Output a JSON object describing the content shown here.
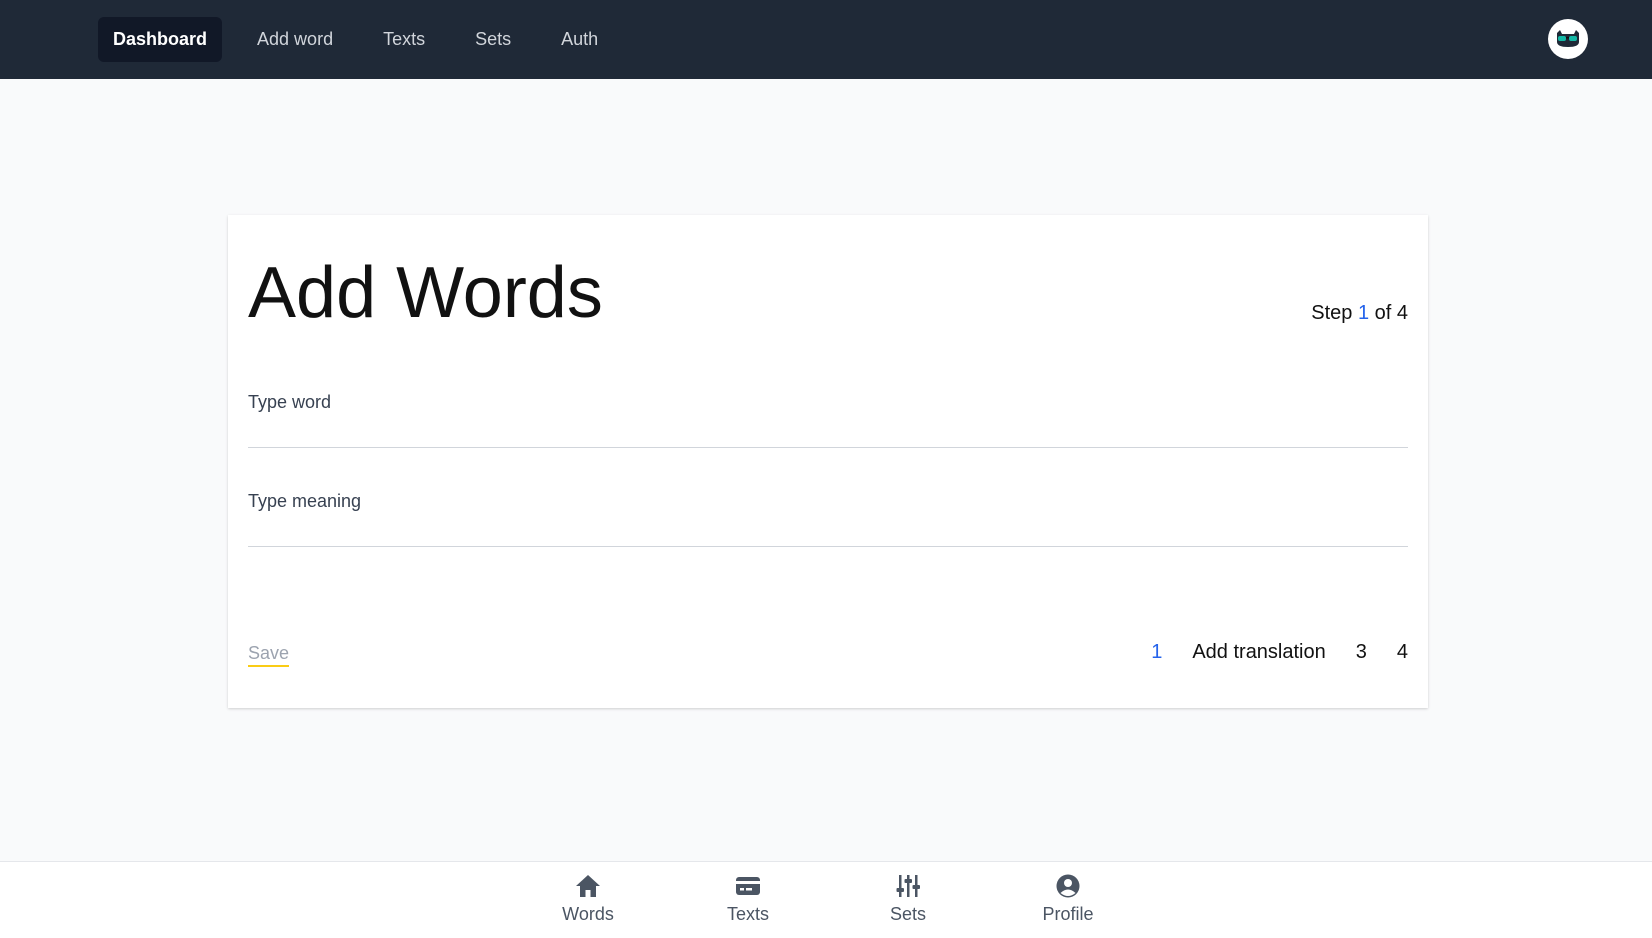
{
  "nav": {
    "items": [
      {
        "label": "Dashboard",
        "active": true
      },
      {
        "label": "Add word",
        "active": false
      },
      {
        "label": "Texts",
        "active": false
      },
      {
        "label": "Sets",
        "active": false
      },
      {
        "label": "Auth",
        "active": false
      }
    ],
    "avatar_icon": "cat-avatar-icon"
  },
  "card": {
    "title": "Add Words",
    "step": {
      "prefix": "Step",
      "current": "1",
      "suffix": "of 4"
    },
    "word_field": {
      "label": "Type word",
      "value": ""
    },
    "meaning_field": {
      "label": "Type meaning",
      "value": ""
    },
    "save_label": "Save",
    "steps": [
      "1",
      "Add translation",
      "3",
      "4"
    ]
  },
  "bottom_nav": {
    "items": [
      {
        "label": "Words",
        "icon": "home-icon"
      },
      {
        "label": "Texts",
        "icon": "card-icon"
      },
      {
        "label": "Sets",
        "icon": "sliders-icon"
      },
      {
        "label": "Profile",
        "icon": "user-circle-icon"
      }
    ]
  },
  "colors": {
    "topbar": "#1f2937",
    "active_nav": "#111827",
    "accent": "#2563eb",
    "save_underline": "#facc15"
  }
}
